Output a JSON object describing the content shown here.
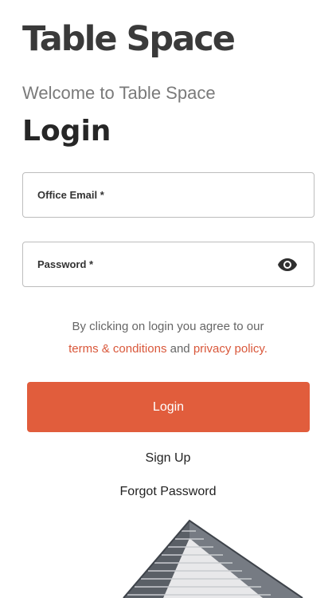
{
  "app": {
    "logo_text": "Table Space"
  },
  "page": {
    "welcome": "Welcome to Table Space",
    "title": "Login"
  },
  "form": {
    "email_label": "Office Email *",
    "password_label": "Password *",
    "agree_prefix": "By clicking on login you agree to our",
    "terms_link": "terms & conditions",
    "and_text": "and",
    "privacy_link": "privacy policy."
  },
  "actions": {
    "login_label": "Login",
    "signup_label": "Sign Up",
    "forgot_label": "Forgot Password"
  },
  "colors": {
    "accent": "#e15d3c",
    "text": "#262626",
    "muted": "#7a7a7a"
  },
  "icons": {
    "password_toggle": "eye-icon"
  }
}
